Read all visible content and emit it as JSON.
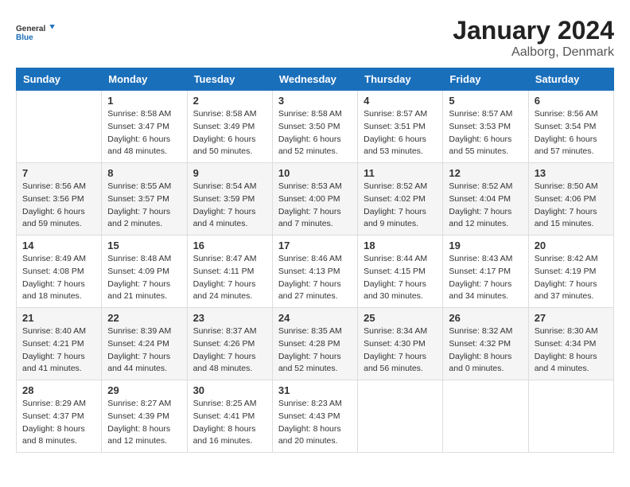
{
  "header": {
    "logo_line1": "General",
    "logo_line2": "Blue",
    "month": "January 2024",
    "location": "Aalborg, Denmark"
  },
  "weekdays": [
    "Sunday",
    "Monday",
    "Tuesday",
    "Wednesday",
    "Thursday",
    "Friday",
    "Saturday"
  ],
  "weeks": [
    [
      {
        "day": "",
        "sunrise": "",
        "sunset": "",
        "daylight": ""
      },
      {
        "day": "1",
        "sunrise": "Sunrise: 8:58 AM",
        "sunset": "Sunset: 3:47 PM",
        "daylight": "Daylight: 6 hours and 48 minutes."
      },
      {
        "day": "2",
        "sunrise": "Sunrise: 8:58 AM",
        "sunset": "Sunset: 3:49 PM",
        "daylight": "Daylight: 6 hours and 50 minutes."
      },
      {
        "day": "3",
        "sunrise": "Sunrise: 8:58 AM",
        "sunset": "Sunset: 3:50 PM",
        "daylight": "Daylight: 6 hours and 52 minutes."
      },
      {
        "day": "4",
        "sunrise": "Sunrise: 8:57 AM",
        "sunset": "Sunset: 3:51 PM",
        "daylight": "Daylight: 6 hours and 53 minutes."
      },
      {
        "day": "5",
        "sunrise": "Sunrise: 8:57 AM",
        "sunset": "Sunset: 3:53 PM",
        "daylight": "Daylight: 6 hours and 55 minutes."
      },
      {
        "day": "6",
        "sunrise": "Sunrise: 8:56 AM",
        "sunset": "Sunset: 3:54 PM",
        "daylight": "Daylight: 6 hours and 57 minutes."
      }
    ],
    [
      {
        "day": "7",
        "sunrise": "Sunrise: 8:56 AM",
        "sunset": "Sunset: 3:56 PM",
        "daylight": "Daylight: 6 hours and 59 minutes."
      },
      {
        "day": "8",
        "sunrise": "Sunrise: 8:55 AM",
        "sunset": "Sunset: 3:57 PM",
        "daylight": "Daylight: 7 hours and 2 minutes."
      },
      {
        "day": "9",
        "sunrise": "Sunrise: 8:54 AM",
        "sunset": "Sunset: 3:59 PM",
        "daylight": "Daylight: 7 hours and 4 minutes."
      },
      {
        "day": "10",
        "sunrise": "Sunrise: 8:53 AM",
        "sunset": "Sunset: 4:00 PM",
        "daylight": "Daylight: 7 hours and 7 minutes."
      },
      {
        "day": "11",
        "sunrise": "Sunrise: 8:52 AM",
        "sunset": "Sunset: 4:02 PM",
        "daylight": "Daylight: 7 hours and 9 minutes."
      },
      {
        "day": "12",
        "sunrise": "Sunrise: 8:52 AM",
        "sunset": "Sunset: 4:04 PM",
        "daylight": "Daylight: 7 hours and 12 minutes."
      },
      {
        "day": "13",
        "sunrise": "Sunrise: 8:50 AM",
        "sunset": "Sunset: 4:06 PM",
        "daylight": "Daylight: 7 hours and 15 minutes."
      }
    ],
    [
      {
        "day": "14",
        "sunrise": "Sunrise: 8:49 AM",
        "sunset": "Sunset: 4:08 PM",
        "daylight": "Daylight: 7 hours and 18 minutes."
      },
      {
        "day": "15",
        "sunrise": "Sunrise: 8:48 AM",
        "sunset": "Sunset: 4:09 PM",
        "daylight": "Daylight: 7 hours and 21 minutes."
      },
      {
        "day": "16",
        "sunrise": "Sunrise: 8:47 AM",
        "sunset": "Sunset: 4:11 PM",
        "daylight": "Daylight: 7 hours and 24 minutes."
      },
      {
        "day": "17",
        "sunrise": "Sunrise: 8:46 AM",
        "sunset": "Sunset: 4:13 PM",
        "daylight": "Daylight: 7 hours and 27 minutes."
      },
      {
        "day": "18",
        "sunrise": "Sunrise: 8:44 AM",
        "sunset": "Sunset: 4:15 PM",
        "daylight": "Daylight: 7 hours and 30 minutes."
      },
      {
        "day": "19",
        "sunrise": "Sunrise: 8:43 AM",
        "sunset": "Sunset: 4:17 PM",
        "daylight": "Daylight: 7 hours and 34 minutes."
      },
      {
        "day": "20",
        "sunrise": "Sunrise: 8:42 AM",
        "sunset": "Sunset: 4:19 PM",
        "daylight": "Daylight: 7 hours and 37 minutes."
      }
    ],
    [
      {
        "day": "21",
        "sunrise": "Sunrise: 8:40 AM",
        "sunset": "Sunset: 4:21 PM",
        "daylight": "Daylight: 7 hours and 41 minutes."
      },
      {
        "day": "22",
        "sunrise": "Sunrise: 8:39 AM",
        "sunset": "Sunset: 4:24 PM",
        "daylight": "Daylight: 7 hours and 44 minutes."
      },
      {
        "day": "23",
        "sunrise": "Sunrise: 8:37 AM",
        "sunset": "Sunset: 4:26 PM",
        "daylight": "Daylight: 7 hours and 48 minutes."
      },
      {
        "day": "24",
        "sunrise": "Sunrise: 8:35 AM",
        "sunset": "Sunset: 4:28 PM",
        "daylight": "Daylight: 7 hours and 52 minutes."
      },
      {
        "day": "25",
        "sunrise": "Sunrise: 8:34 AM",
        "sunset": "Sunset: 4:30 PM",
        "daylight": "Daylight: 7 hours and 56 minutes."
      },
      {
        "day": "26",
        "sunrise": "Sunrise: 8:32 AM",
        "sunset": "Sunset: 4:32 PM",
        "daylight": "Daylight: 8 hours and 0 minutes."
      },
      {
        "day": "27",
        "sunrise": "Sunrise: 8:30 AM",
        "sunset": "Sunset: 4:34 PM",
        "daylight": "Daylight: 8 hours and 4 minutes."
      }
    ],
    [
      {
        "day": "28",
        "sunrise": "Sunrise: 8:29 AM",
        "sunset": "Sunset: 4:37 PM",
        "daylight": "Daylight: 8 hours and 8 minutes."
      },
      {
        "day": "29",
        "sunrise": "Sunrise: 8:27 AM",
        "sunset": "Sunset: 4:39 PM",
        "daylight": "Daylight: 8 hours and 12 minutes."
      },
      {
        "day": "30",
        "sunrise": "Sunrise: 8:25 AM",
        "sunset": "Sunset: 4:41 PM",
        "daylight": "Daylight: 8 hours and 16 minutes."
      },
      {
        "day": "31",
        "sunrise": "Sunrise: 8:23 AM",
        "sunset": "Sunset: 4:43 PM",
        "daylight": "Daylight: 8 hours and 20 minutes."
      },
      {
        "day": "",
        "sunrise": "",
        "sunset": "",
        "daylight": ""
      },
      {
        "day": "",
        "sunrise": "",
        "sunset": "",
        "daylight": ""
      },
      {
        "day": "",
        "sunrise": "",
        "sunset": "",
        "daylight": ""
      }
    ]
  ]
}
